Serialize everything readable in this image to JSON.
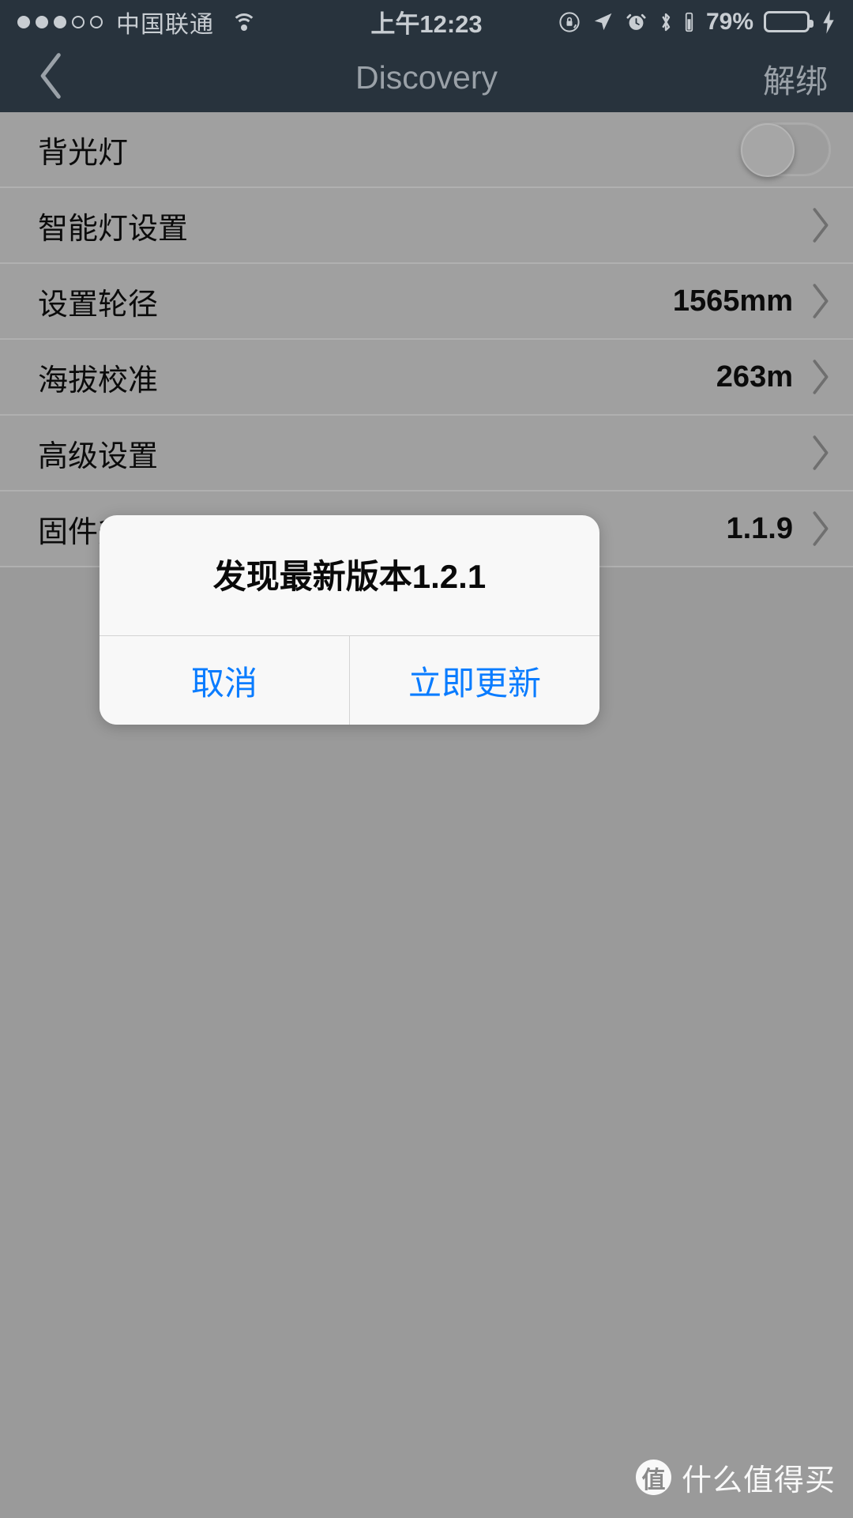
{
  "status_bar": {
    "signal_dots_filled": 3,
    "signal_dots_total": 5,
    "carrier": "中国联通",
    "wifi_icon": "wifi-icon",
    "time": "上午12:23",
    "icons": [
      "rotation-lock-icon",
      "location-arrow-icon",
      "alarm-clock-icon",
      "bluetooth-icon"
    ],
    "battery_percent": "79%",
    "battery_level_pct": 79,
    "battery_color": "#c8a400",
    "charging_icon": "lightning-bolt-icon"
  },
  "nav_bar": {
    "back_icon": "chevron-left-icon",
    "title": "Discovery",
    "action_label": "解绑",
    "background": "#28333d",
    "title_color": "#9aa1a8"
  },
  "settings_list": {
    "rows": [
      {
        "label": "背光灯",
        "value": "",
        "control": "toggle",
        "toggle_on": false
      },
      {
        "label": "智能灯设置",
        "value": "",
        "control": "chevron"
      },
      {
        "label": "设置轮径",
        "value": "1565mm",
        "control": "chevron"
      },
      {
        "label": "海拔校准",
        "value": "263m",
        "control": "chevron"
      },
      {
        "label": "高级设置",
        "value": "",
        "control": "chevron"
      },
      {
        "label": "固件升级",
        "value": "1.1.9",
        "control": "chevron"
      }
    ]
  },
  "alert": {
    "title": "发现最新版本1.2.1",
    "cancel_label": "取消",
    "confirm_label": "立即更新",
    "button_color": "#0a7cff"
  },
  "watermark": {
    "logo_char": "值",
    "text": "什么值得买"
  }
}
